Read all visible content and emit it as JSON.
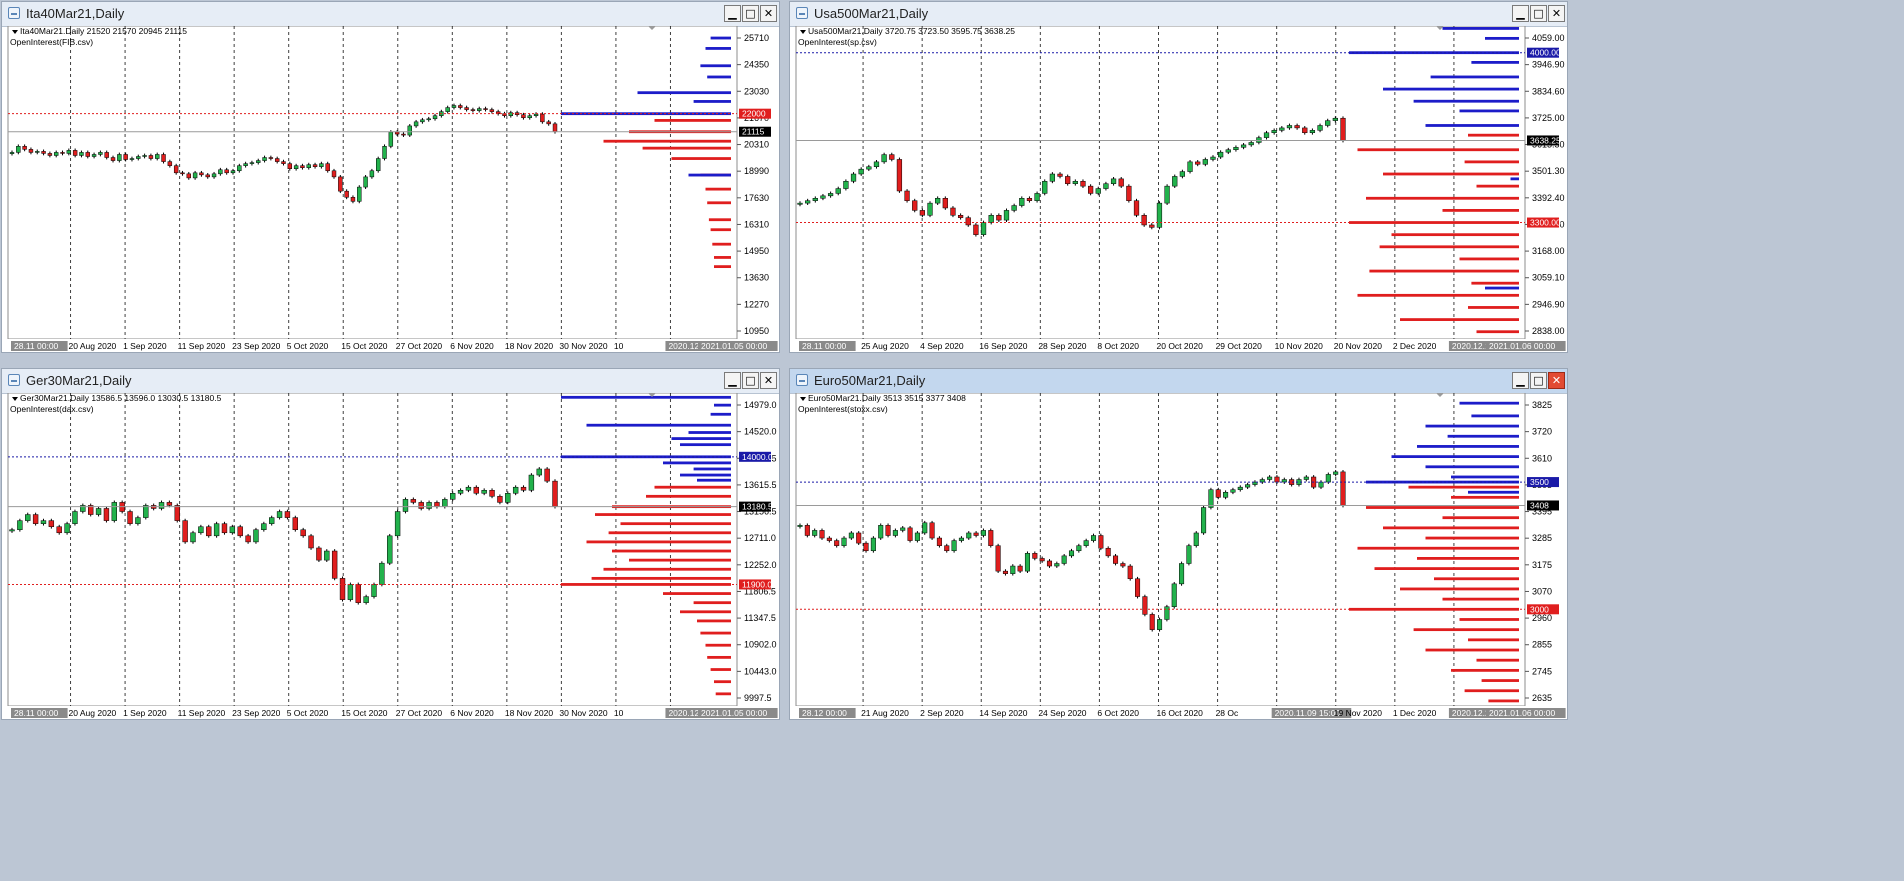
{
  "windows": [
    {
      "id": "ita40",
      "title": "Ita40Mar21,Daily",
      "header": "Ita40Mar21.Daily  21520 21570 20945 21115",
      "indicator": "OpenInterest(FIB.csv)",
      "date_labels": [
        "28.11 00:00",
        "20 Aug 2020",
        "1 Sep 2020",
        "11 Sep 2020",
        "23 Sep 2020",
        "5 Oct 2020",
        "15 Oct 2020",
        "27 Oct 2020",
        "6 Nov 2020",
        "18 Nov 2020",
        "30 Nov 2020",
        "10",
        "2020.12.20 00:00",
        "2021.01.05 00:00"
      ],
      "price_labels": [
        "25710",
        "24350",
        "23030",
        "21670",
        "20310",
        "18990",
        "17630",
        "16310",
        "14950",
        "13630",
        "12270",
        "10950"
      ],
      "marker_labels": [
        {
          "label": "22000",
          "price": 22000,
          "color": "#e01e1e"
        },
        {
          "label": "21115",
          "price": 21115,
          "color": "#000000"
        }
      ]
    },
    {
      "id": "usa500",
      "title": "Usa500Mar21,Daily",
      "header": "Usa500Mar21.Daily  3720.75 3723.50 3595.75 3638.25",
      "indicator": "OpenInterest(sp.csv)",
      "date_labels": [
        "28.11 00:00",
        "25 Aug 2020",
        "4 Sep 2020",
        "16 Sep 2020",
        "28 Sep 2020",
        "8 Oct 2020",
        "20 Oct 2020",
        "29 Oct 2020",
        "10 Nov 2020",
        "20 Nov 2020",
        "2 Dec 2020",
        "2020.12.17 00:00",
        "2021.01.06 00:00"
      ],
      "price_labels": [
        "4059.00",
        "3946.90",
        "3834.60",
        "3725.00",
        "3613.50",
        "3501.30",
        "3392.40",
        "3280.20",
        "3168.00",
        "3059.10",
        "2946.90",
        "2838.00"
      ],
      "marker_labels": [
        {
          "label": "4000.00",
          "price": 4000,
          "color": "#1a1aa8"
        },
        {
          "label": "3638.25",
          "price": 3638.25,
          "color": "#000000"
        },
        {
          "label": "3300.00",
          "price": 3300,
          "color": "#e01e1e"
        }
      ]
    },
    {
      "id": "ger30",
      "title": "Ger30Mar21,Daily",
      "header": "Ger30Mar21.Daily  13586.5 13596.0 13030.5 13180.5",
      "indicator": "OpenInterest(dax.csv)",
      "date_labels": [
        "28.11 00:00",
        "20 Aug 2020",
        "1 Sep 2020",
        "11 Sep 2020",
        "23 Sep 2020",
        "5 Oct 2020",
        "15 Oct 2020",
        "27 Oct 2020",
        "6 Nov 2020",
        "18 Nov 2020",
        "30 Nov 2020",
        "10",
        "2020.12.18 00:00",
        "2021.01.05 00:00"
      ],
      "price_labels": [
        "14979.0",
        "14520.0",
        "14061.5",
        "13615.5",
        "13156.5",
        "12711.0",
        "12252.0",
        "11806.5",
        "11347.5",
        "10902.0",
        "10443.0",
        "9997.5"
      ],
      "marker_labels": [
        {
          "label": "14000.0",
          "price": 14000,
          "color": "#1a1aa8"
        },
        {
          "label": "13180.5",
          "price": 13180.5,
          "color": "#000000"
        },
        {
          "label": "11900.0",
          "price": 11900,
          "color": "#e01e1e"
        }
      ]
    },
    {
      "id": "euro50",
      "title": "Euro50Mar21,Daily",
      "header": "Euro50Mar21.Daily  3513 3515 3377 3408",
      "indicator": "OpenInterest(stoxx.csv)",
      "date_labels": [
        "28.12 00:00",
        "21 Aug 2020",
        "2 Sep 2020",
        "14 Sep 2020",
        "24 Sep 2020",
        "6 Oct 2020",
        "16 Oct 2020",
        "28 Oc",
        "2020.11.09 15:00",
        "19 Nov 2020",
        "1 Dec 2020",
        "2020.12.20 00:00",
        "2021.01.06 00:00"
      ],
      "price_labels": [
        "3825",
        "3720",
        "3610",
        "3505",
        "3395",
        "3285",
        "3175",
        "3070",
        "2960",
        "2855",
        "2745",
        "2635"
      ],
      "marker_labels": [
        {
          "label": "3500",
          "price": 3500,
          "color": "#1a1aa8"
        },
        {
          "label": "3408",
          "price": 3408,
          "color": "#000000"
        },
        {
          "label": "3000",
          "price": 3000,
          "color": "#e01e1e"
        }
      ]
    }
  ],
  "chart_data": [
    {
      "type": "candlestick",
      "title": "Ita40Mar21.Daily",
      "ylim": [
        10950,
        26300
      ],
      "candles_close": [
        20100,
        20400,
        20250,
        20100,
        20150,
        20050,
        19950,
        20100,
        20050,
        20200,
        19950,
        20100,
        19900,
        20000,
        20100,
        19850,
        19700,
        20000,
        19750,
        19800,
        19900,
        19950,
        19800,
        20000,
        19650,
        19450,
        19100,
        19050,
        18850,
        19100,
        19000,
        18900,
        19050,
        19250,
        19100,
        19200,
        19450,
        19550,
        19600,
        19700,
        19850,
        19800,
        19650,
        19550,
        19300,
        19450,
        19350,
        19500,
        19400,
        19550,
        19200,
        18900,
        18200,
        17900,
        17700,
        18400,
        18900,
        19200,
        19800,
        20400,
        21100,
        21000,
        20950,
        21400,
        21600,
        21700,
        21750,
        21900,
        22100,
        22300,
        22400,
        22300,
        22200,
        22150,
        22250,
        22200,
        22100,
        22000,
        21900,
        22050,
        21950,
        21800,
        21900,
        21980,
        21600,
        21500,
        21115
      ],
      "open_interest_calls": [
        {
          "price": 25710,
          "length": 0.12
        },
        {
          "price": 25200,
          "length": 0.15
        },
        {
          "price": 24350,
          "length": 0.18
        },
        {
          "price": 23800,
          "length": 0.14
        },
        {
          "price": 23030,
          "length": 0.55
        },
        {
          "price": 22600,
          "length": 0.22
        },
        {
          "price": 22000,
          "length": 1.0
        },
        {
          "price": 18990,
          "length": 0.25
        }
      ],
      "open_interest_puts": [
        {
          "price": 21670,
          "length": 0.45
        },
        {
          "price": 21115,
          "length": 0.6
        },
        {
          "price": 20650,
          "length": 0.75
        },
        {
          "price": 20310,
          "length": 0.52
        },
        {
          "price": 19800,
          "length": 0.35
        },
        {
          "price": 18990,
          "length": 0.18
        },
        {
          "price": 18300,
          "length": 0.15
        },
        {
          "price": 17630,
          "length": 0.14
        },
        {
          "price": 16800,
          "length": 0.13
        },
        {
          "price": 16310,
          "length": 0.12
        },
        {
          "price": 15600,
          "length": 0.11
        },
        {
          "price": 14950,
          "length": 0.1
        },
        {
          "price": 14500,
          "length": 0.1
        }
      ]
    },
    {
      "type": "candlestick",
      "title": "Usa500Mar21.Daily",
      "ylim": [
        2820,
        4110
      ],
      "candles_close": [
        3380,
        3390,
        3400,
        3410,
        3420,
        3440,
        3470,
        3500,
        3520,
        3530,
        3550,
        3580,
        3560,
        3430,
        3390,
        3350,
        3330,
        3380,
        3400,
        3360,
        3330,
        3320,
        3290,
        3250,
        3300,
        3330,
        3310,
        3350,
        3370,
        3400,
        3390,
        3420,
        3470,
        3500,
        3490,
        3460,
        3470,
        3450,
        3420,
        3440,
        3460,
        3480,
        3450,
        3390,
        3330,
        3290,
        3280,
        3380,
        3450,
        3490,
        3510,
        3550,
        3540,
        3560,
        3570,
        3590,
        3600,
        3610,
        3620,
        3630,
        3650,
        3670,
        3680,
        3690,
        3700,
        3690,
        3670,
        3680,
        3700,
        3720,
        3730,
        3638.25
      ],
      "open_interest_calls": [
        {
          "price": 4100,
          "length": 0.45
        },
        {
          "price": 4059,
          "length": 0.2
        },
        {
          "price": 4000,
          "length": 1.0
        },
        {
          "price": 3960,
          "length": 0.28
        },
        {
          "price": 3900,
          "length": 0.52
        },
        {
          "price": 3850,
          "length": 0.8
        },
        {
          "price": 3800,
          "length": 0.62
        },
        {
          "price": 3760,
          "length": 0.35
        },
        {
          "price": 3700,
          "length": 0.55
        },
        {
          "price": 3480,
          "length": 0.05
        },
        {
          "price": 3030,
          "length": 0.2
        }
      ],
      "open_interest_puts": [
        {
          "price": 3660,
          "length": 0.3
        },
        {
          "price": 3600,
          "length": 0.95
        },
        {
          "price": 3550,
          "length": 0.32
        },
        {
          "price": 3500,
          "length": 0.8
        },
        {
          "price": 3450,
          "length": 0.25
        },
        {
          "price": 3400,
          "length": 0.9
        },
        {
          "price": 3350,
          "length": 0.45
        },
        {
          "price": 3300,
          "length": 1.0
        },
        {
          "price": 3250,
          "length": 0.75
        },
        {
          "price": 3200,
          "length": 0.82
        },
        {
          "price": 3150,
          "length": 0.35
        },
        {
          "price": 3100,
          "length": 0.88
        },
        {
          "price": 3050,
          "length": 0.28
        },
        {
          "price": 3000,
          "length": 0.95
        },
        {
          "price": 2950,
          "length": 0.3
        },
        {
          "price": 2900,
          "length": 0.7
        },
        {
          "price": 2850,
          "length": 0.25
        }
      ]
    },
    {
      "type": "candlestick",
      "title": "Ger30Mar21.Daily",
      "ylim": [
        9900,
        15050
      ],
      "candles_close": [
        12800,
        12950,
        13050,
        12900,
        12950,
        12850,
        12750,
        12900,
        13100,
        13200,
        13050,
        13150,
        12950,
        13250,
        13100,
        12900,
        13000,
        13200,
        13150,
        13250,
        13200,
        12950,
        12600,
        12750,
        12850,
        12700,
        12900,
        12750,
        12850,
        12700,
        12600,
        12800,
        12900,
        13000,
        13100,
        13000,
        12800,
        12700,
        12500,
        12300,
        12450,
        12000,
        11650,
        11900,
        11600,
        11700,
        11900,
        12250,
        12700,
        13100,
        13300,
        13250,
        13150,
        13250,
        13180,
        13300,
        13400,
        13450,
        13500,
        13400,
        13450,
        13350,
        13250,
        13400,
        13500,
        13450,
        13700,
        13800,
        13600,
        13180.5
      ],
      "open_interest_calls": [
        {
          "price": 14979,
          "length": 1.0
        },
        {
          "price": 14850,
          "length": 0.1
        },
        {
          "price": 14700,
          "length": 0.12
        },
        {
          "price": 14520,
          "length": 0.85
        },
        {
          "price": 14400,
          "length": 0.25
        },
        {
          "price": 14300,
          "length": 0.35
        },
        {
          "price": 14200,
          "length": 0.3
        },
        {
          "price": 14000,
          "length": 1.0
        },
        {
          "price": 13900,
          "length": 0.4
        },
        {
          "price": 13800,
          "length": 0.22
        },
        {
          "price": 13700,
          "length": 0.3
        },
        {
          "price": 13615,
          "length": 0.2
        }
      ],
      "open_interest_puts": [
        {
          "price": 13500,
          "length": 0.45
        },
        {
          "price": 13350,
          "length": 0.5
        },
        {
          "price": 13180,
          "length": 0.7
        },
        {
          "price": 13050,
          "length": 0.8
        },
        {
          "price": 12900,
          "length": 0.65
        },
        {
          "price": 12750,
          "length": 0.72
        },
        {
          "price": 12600,
          "length": 0.85
        },
        {
          "price": 12450,
          "length": 0.7
        },
        {
          "price": 12300,
          "length": 0.6
        },
        {
          "price": 12150,
          "length": 0.75
        },
        {
          "price": 12000,
          "length": 0.82
        },
        {
          "price": 11900,
          "length": 1.0
        },
        {
          "price": 11750,
          "length": 0.4
        },
        {
          "price": 11600,
          "length": 0.22
        },
        {
          "price": 11450,
          "length": 0.3
        },
        {
          "price": 11300,
          "length": 0.2
        },
        {
          "price": 11100,
          "length": 0.18
        },
        {
          "price": 10900,
          "length": 0.15
        },
        {
          "price": 10700,
          "length": 0.14
        },
        {
          "price": 10500,
          "length": 0.12
        },
        {
          "price": 10300,
          "length": 0.1
        },
        {
          "price": 10100,
          "length": 0.09
        }
      ]
    },
    {
      "type": "candlestick",
      "title": "Euro50Mar21.Daily",
      "ylim": [
        2620,
        3850
      ],
      "candles_close": [
        3330,
        3290,
        3310,
        3280,
        3270,
        3250,
        3280,
        3300,
        3260,
        3230,
        3280,
        3330,
        3290,
        3310,
        3320,
        3270,
        3300,
        3340,
        3280,
        3250,
        3230,
        3270,
        3280,
        3300,
        3290,
        3310,
        3250,
        3150,
        3140,
        3170,
        3150,
        3220,
        3200,
        3190,
        3170,
        3180,
        3210,
        3230,
        3250,
        3270,
        3290,
        3240,
        3210,
        3180,
        3170,
        3120,
        3050,
        2980,
        2920,
        2960,
        3010,
        3100,
        3180,
        3250,
        3300,
        3400,
        3470,
        3440,
        3460,
        3470,
        3480,
        3490,
        3500,
        3510,
        3520,
        3500,
        3510,
        3490,
        3510,
        3520,
        3480,
        3500,
        3530,
        3540,
        3408
      ],
      "open_interest_calls": [
        {
          "price": 3810,
          "length": 0.35
        },
        {
          "price": 3760,
          "length": 0.28
        },
        {
          "price": 3720,
          "length": 0.55
        },
        {
          "price": 3680,
          "length": 0.42
        },
        {
          "price": 3640,
          "length": 0.6
        },
        {
          "price": 3600,
          "length": 0.75
        },
        {
          "price": 3560,
          "length": 0.55
        },
        {
          "price": 3520,
          "length": 0.4
        },
        {
          "price": 3500,
          "length": 0.9
        },
        {
          "price": 3460,
          "length": 0.3
        }
      ],
      "open_interest_puts": [
        {
          "price": 3480,
          "length": 0.65
        },
        {
          "price": 3440,
          "length": 0.4
        },
        {
          "price": 3400,
          "length": 0.9
        },
        {
          "price": 3360,
          "length": 0.45
        },
        {
          "price": 3320,
          "length": 0.8
        },
        {
          "price": 3280,
          "length": 0.55
        },
        {
          "price": 3240,
          "length": 0.95
        },
        {
          "price": 3200,
          "length": 0.6
        },
        {
          "price": 3160,
          "length": 0.85
        },
        {
          "price": 3120,
          "length": 0.5
        },
        {
          "price": 3080,
          "length": 0.7
        },
        {
          "price": 3040,
          "length": 0.45
        },
        {
          "price": 3000,
          "length": 1.0
        },
        {
          "price": 2960,
          "length": 0.35
        },
        {
          "price": 2920,
          "length": 0.62
        },
        {
          "price": 2880,
          "length": 0.3
        },
        {
          "price": 2840,
          "length": 0.55
        },
        {
          "price": 2800,
          "length": 0.25
        },
        {
          "price": 2760,
          "length": 0.4
        },
        {
          "price": 2720,
          "length": 0.22
        },
        {
          "price": 2680,
          "length": 0.32
        },
        {
          "price": 2640,
          "length": 0.18
        }
      ]
    }
  ]
}
